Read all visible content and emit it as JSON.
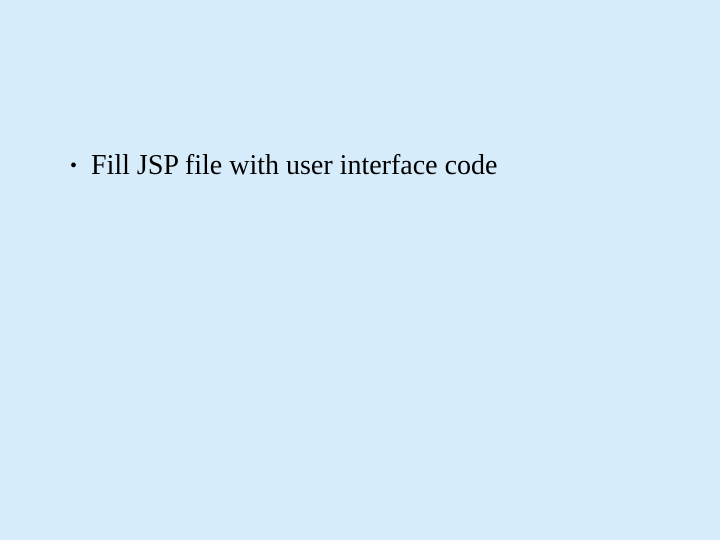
{
  "slide": {
    "bullets": [
      {
        "text": "Fill JSP file with user interface code"
      }
    ]
  }
}
